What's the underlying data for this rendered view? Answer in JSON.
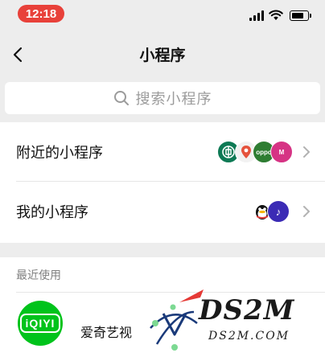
{
  "status_bar": {
    "time": "12:18",
    "icons": [
      "signal-icon",
      "wifi-icon",
      "battery-icon"
    ]
  },
  "nav": {
    "title": "小程序",
    "back_icon": "chevron-left-icon"
  },
  "search": {
    "placeholder": "搜索小程序",
    "icon": "search-icon"
  },
  "menu": [
    {
      "label": "附近的小程序",
      "avatars": [
        {
          "label": "中国银行",
          "color": "#0e7a55"
        },
        {
          "label": "地图",
          "color": "#f2f2f2"
        },
        {
          "label": "oppo",
          "color": "#2e7d32"
        },
        {
          "label": "M",
          "color": "#d63384"
        }
      ]
    },
    {
      "label": "我的小程序",
      "avatars": [
        {
          "label": "QQ",
          "color": "#ffffff"
        },
        {
          "label": "♪",
          "color": "#3b2bb5"
        }
      ]
    }
  ],
  "recent": {
    "header": "最近使用",
    "items": [
      {
        "name": "爱奇艺视",
        "icon_text": "iQIYI",
        "color": "#00c31b"
      }
    ]
  },
  "watermark": {
    "text": "DS2M",
    "subtext": "DS2M.COM"
  }
}
